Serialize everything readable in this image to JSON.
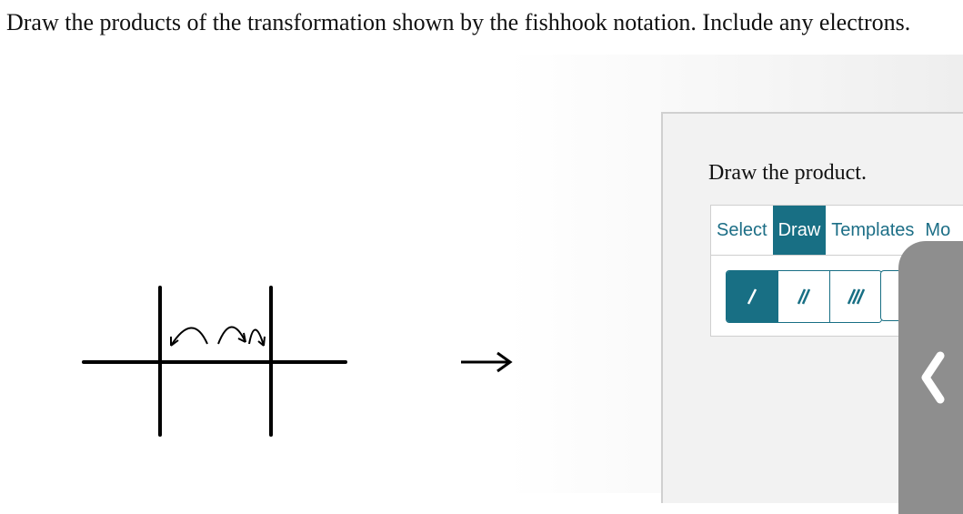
{
  "question": "Draw the products of the transformation shown by the fishhook notation. Include any electrons.",
  "panel": {
    "title": "Draw the product.",
    "tabs": [
      {
        "label": "Select",
        "active": false
      },
      {
        "label": "Draw",
        "active": true
      },
      {
        "label": "Templates",
        "active": false
      },
      {
        "label": "Mo",
        "active": false
      }
    ],
    "bond_tools": [
      {
        "icon": "single-bond-icon",
        "active": true
      },
      {
        "icon": "double-bond-icon",
        "active": false
      },
      {
        "icon": "triple-bond-icon",
        "active": false
      }
    ]
  },
  "side_handle": {
    "icon": "chevron-left-icon"
  },
  "colors": {
    "accent": "#186f84",
    "handle": "#8e8e8e",
    "panel_bg": "#f2f2f2"
  }
}
